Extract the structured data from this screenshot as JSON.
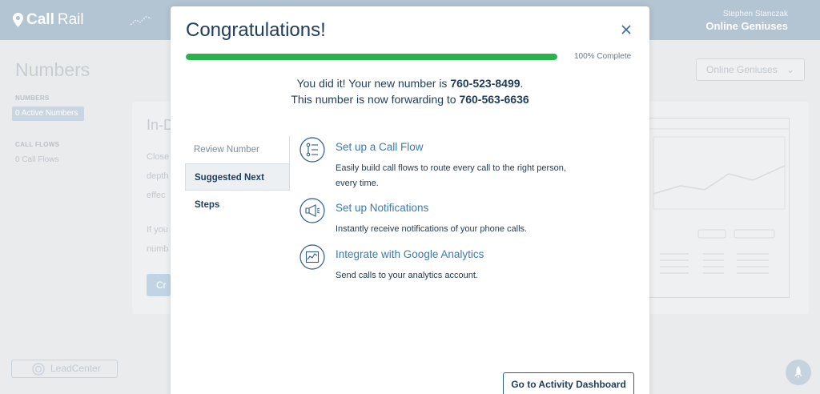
{
  "header": {
    "logo_text_a": "Call",
    "logo_text_b": "Rail",
    "user_name": "Stephen Stanczak",
    "org_name": "Online Geniuses"
  },
  "background": {
    "page_title": "Numbers",
    "sidebar": {
      "numbers_heading": "NUMBERS",
      "active_numbers": "0 Active Numbers",
      "call_flows_heading": "CALL FLOWS",
      "call_flows_link": "0 Call Flows"
    },
    "card": {
      "title": "In-D",
      "line1": "Close",
      "line2": "depth",
      "line3": "effec",
      "line4": "If you",
      "line5": "numb",
      "button": "Cr"
    },
    "account_select": "Online Geniuses",
    "leadcenter": "LeadCenter"
  },
  "modal": {
    "title": "Congratulations!",
    "progress": {
      "percent": 100,
      "label": "100% Complete"
    },
    "message": {
      "line1_prefix": "You did it! Your new number is ",
      "new_number": "760-523-8499",
      "line1_suffix": ".",
      "line2_prefix": "This number is now forwarding to ",
      "forward_number": "760-563-6636"
    },
    "tabs": [
      {
        "label": "Review Number",
        "active": false
      },
      {
        "label": "Suggested Next Steps",
        "active": true
      }
    ],
    "steps": [
      {
        "icon": "call-flow-icon",
        "title": "Set up a Call Flow",
        "description": "Easily build call flows to route every call to the right person, every time."
      },
      {
        "icon": "megaphone-icon",
        "title": "Set up Notifications",
        "description": "Instantly receive notifications of your phone calls."
      },
      {
        "icon": "analytics-chart-icon",
        "title": "Integrate with Google Analytics",
        "description": "Send calls to your analytics account."
      }
    ],
    "dashboard_button": "Go to Activity Dashboard"
  },
  "colors": {
    "progress_green": "#2bb34b",
    "link_blue": "#3a7ab5",
    "navy": "#1f3d5b"
  }
}
